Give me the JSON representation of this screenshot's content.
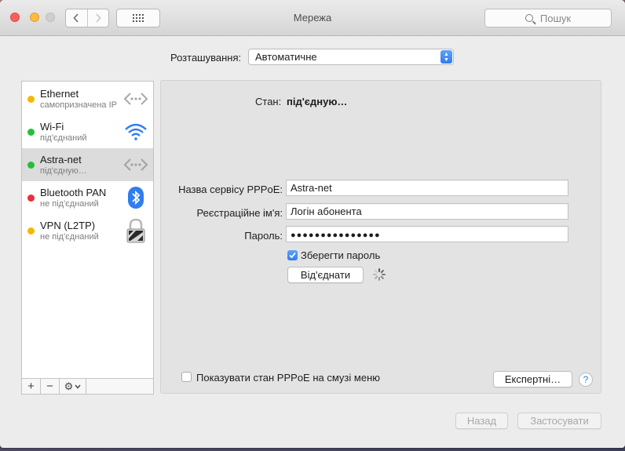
{
  "window": {
    "title": "Мережа",
    "search_placeholder": "Пошук"
  },
  "location": {
    "label": "Розташування:",
    "value": "Автоматичне"
  },
  "services": [
    {
      "name": "Ethernet",
      "status": "самопризначена IP",
      "dot_color": "#f5b800",
      "icon": "ethernet-icon"
    },
    {
      "name": "Wi-Fi",
      "status": "під'єднаний",
      "dot_color": "#22c03a",
      "icon": "wifi-icon"
    },
    {
      "name": "Astra-net",
      "status": "під'єдную…",
      "dot_color": "#22c03a",
      "icon": "ethernet-icon"
    },
    {
      "name": "Bluetooth PAN",
      "status": "не під'єднаний",
      "dot_color": "#ea2f3a",
      "icon": "bluetooth-icon"
    },
    {
      "name": "VPN (L2TP)",
      "status": "не під'єднаний",
      "dot_color": "#f5b800",
      "icon": "lock-icon"
    }
  ],
  "selected_service": "Astra-net",
  "sidebar_toolbar": {
    "add": "+",
    "remove": "−",
    "gear": "⚙"
  },
  "detail": {
    "status_label": "Стан:",
    "status_value": "під'єдную…",
    "service_name_label": "Назва сервісу PPPoE:",
    "service_name_value": "Astra-net",
    "account_label": "Реєстраційне ім'я:",
    "account_value": "Логін абонента",
    "password_label": "Пароль:",
    "password_value": "●●●●●●●●●●●●●●●",
    "save_password_label": "Зберегти пароль",
    "save_password_checked": true,
    "disconnect_button": "Від'єднати",
    "show_pppoe_label": "Показувати стан PPPoE на смузі меню",
    "show_pppoe_checked": false,
    "advanced_button": "Експертні…",
    "help": "?"
  },
  "footer": {
    "revert_button": "Назад",
    "apply_button": "Застосувати"
  },
  "colors": {
    "accent": "#2f7df0",
    "dot_yellow": "#f5b800",
    "dot_green": "#22c03a",
    "dot_red": "#ea2f3a"
  }
}
